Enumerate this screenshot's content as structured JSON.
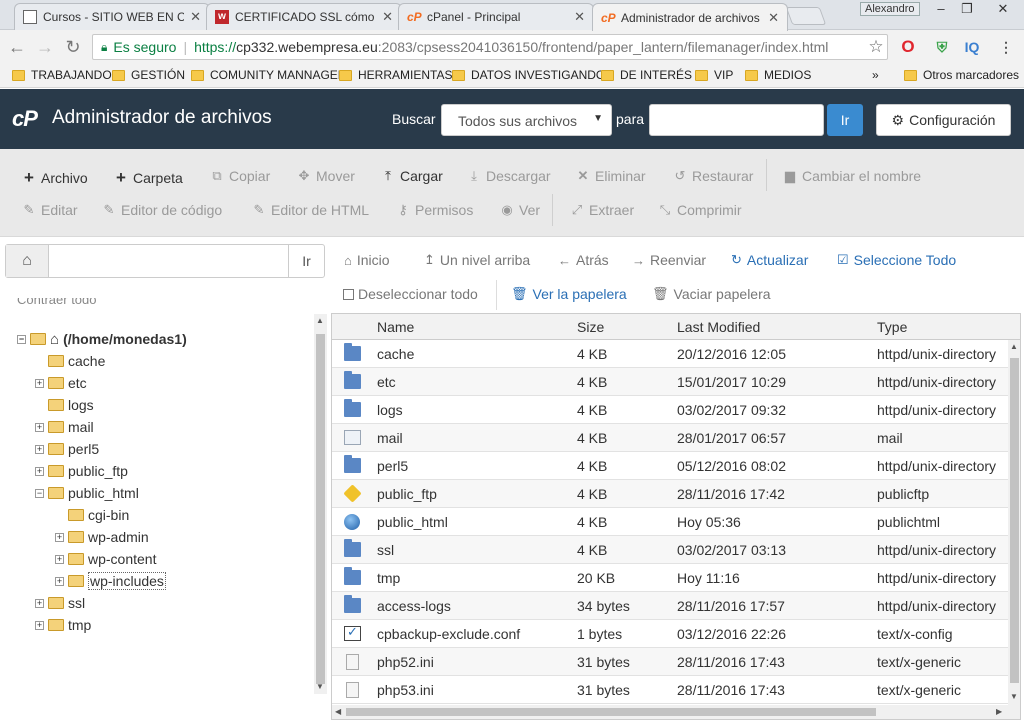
{
  "browser": {
    "tabs": [
      {
        "title": "Cursos - SITIO WEB EN CO"
      },
      {
        "title": "CERTIFICADO SSL cómo lo"
      },
      {
        "title": "cPanel - Principal"
      },
      {
        "title": "Administrador de archivos c"
      }
    ],
    "profile_name": "Alexandro",
    "secure_label": "Es seguro",
    "url_scheme": "https://",
    "url_host": "cp332.webempresa.eu",
    "url_path": ":2083/cpsess2041036150/frontend/paper_lantern/filemanager/index.html",
    "bookmarks": [
      "TRABAJANDO",
      "GESTIÓN",
      "COMUNITY MANNAGER",
      "HERRAMIENTAS",
      "DATOS INVESTIGANDO",
      "DE INTERÉS",
      "VIP",
      "MEDIOS"
    ],
    "bookmarks_more": "»",
    "other_bookmarks": "Otros marcadores"
  },
  "cpanel": {
    "logo": "cP",
    "title": "Administrador de archivos",
    "search_label": "Buscar",
    "search_scope": "Todos sus archivos",
    "search_for_label": "para",
    "go_label": "Ir",
    "config_label": "Configuración"
  },
  "toolbar": {
    "file": "Archivo",
    "folder": "Carpeta",
    "copy": "Copiar",
    "move": "Mover",
    "upload": "Cargar",
    "download": "Descargar",
    "delete": "Eliminar",
    "restore": "Restaurar",
    "rename": "Cambiar el nombre",
    "edit": "Editar",
    "code_editor": "Editor de código",
    "html_editor": "Editor de HTML",
    "permissions": "Permisos",
    "view": "Ver",
    "extract": "Extraer",
    "compress": "Comprimir"
  },
  "path_bar": {
    "go_label": "Ir"
  },
  "tree": {
    "collapse_all": "Contraer todo",
    "root": "(/home/monedas1)",
    "items": [
      "cache",
      "etc",
      "logs",
      "mail",
      "perl5",
      "public_ftp",
      "public_html",
      "cgi-bin",
      "wp-admin",
      "wp-content",
      "wp-includes",
      "ssl",
      "tmp"
    ]
  },
  "nav": {
    "home": "Inicio",
    "up": "Un nivel arriba",
    "back": "Atrás",
    "forward": "Reenviar",
    "reload": "Actualizar",
    "select_all": "Seleccione Todo",
    "unselect_all": "Deseleccionar todo",
    "view_trash": "Ver la papelera",
    "empty_trash": "Vaciar papelera"
  },
  "table": {
    "columns": [
      "Name",
      "Size",
      "Last Modified",
      "Type"
    ],
    "rows": [
      {
        "name": "cache",
        "size": "4 KB",
        "modified": "20/12/2016 12:05",
        "type": "httpd/unix-directory",
        "icon": "folder-icon"
      },
      {
        "name": "etc",
        "size": "4 KB",
        "modified": "15/01/2017 10:29",
        "type": "httpd/unix-directory",
        "icon": "folder-icon"
      },
      {
        "name": "logs",
        "size": "4 KB",
        "modified": "03/02/2017 09:32",
        "type": "httpd/unix-directory",
        "icon": "folder-icon"
      },
      {
        "name": "mail",
        "size": "4 KB",
        "modified": "28/01/2017 06:57",
        "type": "mail",
        "icon": "mail-icon"
      },
      {
        "name": "perl5",
        "size": "4 KB",
        "modified": "05/12/2016 08:02",
        "type": "httpd/unix-directory",
        "icon": "folder-icon"
      },
      {
        "name": "public_ftp",
        "size": "4 KB",
        "modified": "28/11/2016 17:42",
        "type": "publicftp",
        "icon": "ftp-icon"
      },
      {
        "name": "public_html",
        "size": "4 KB",
        "modified": "Hoy 05:36",
        "type": "publichtml",
        "icon": "globe-icon"
      },
      {
        "name": "ssl",
        "size": "4 KB",
        "modified": "03/02/2017 03:13",
        "type": "httpd/unix-directory",
        "icon": "folder-icon"
      },
      {
        "name": "tmp",
        "size": "20 KB",
        "modified": "Hoy 11:16",
        "type": "httpd/unix-directory",
        "icon": "folder-icon"
      },
      {
        "name": "access-logs",
        "size": "34 bytes",
        "modified": "28/11/2016 17:57",
        "type": "httpd/unix-directory",
        "icon": "folder-icon"
      },
      {
        "name": "cpbackup-exclude.conf",
        "size": "1 bytes",
        "modified": "03/12/2016 22:26",
        "type": "text/x-config",
        "icon": "config-file-icon"
      },
      {
        "name": "php52.ini",
        "size": "31 bytes",
        "modified": "28/11/2016 17:43",
        "type": "text/x-generic",
        "icon": "text-file-icon"
      },
      {
        "name": "php53.ini",
        "size": "31 bytes",
        "modified": "28/11/2016 17:43",
        "type": "text/x-generic",
        "icon": "text-file-icon"
      }
    ]
  },
  "colors": {
    "header_bg": "#293a4a",
    "accent": "#3a8bd0",
    "link": "#2a6fb5",
    "secure_green": "#0b8043"
  }
}
